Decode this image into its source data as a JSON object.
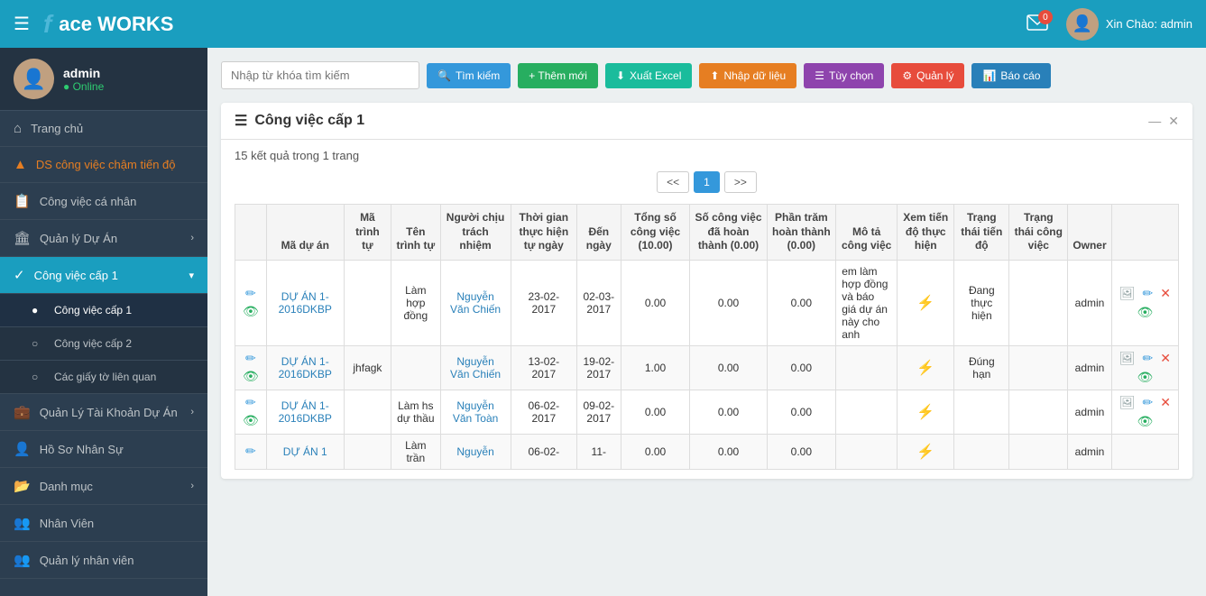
{
  "header": {
    "logo_face": "f",
    "logo_text": "ace WORKS",
    "hamburger": "☰",
    "mail_badge": "0",
    "greeting": "Xin Chào: admin"
  },
  "sidebar": {
    "user": {
      "name": "admin",
      "status": "● Online"
    },
    "items": [
      {
        "id": "home",
        "icon": "⌂",
        "label": "Trang chủ",
        "arrow": ""
      },
      {
        "id": "late-tasks",
        "icon": "▲",
        "label": "DS công việc chậm tiến độ",
        "arrow": ""
      },
      {
        "id": "personal-tasks",
        "icon": "📋",
        "label": "Công việc cá nhân",
        "arrow": ""
      },
      {
        "id": "project-mgmt",
        "icon": "🏛",
        "label": "Quản lý Dự Án",
        "arrow": "›"
      },
      {
        "id": "task-level1",
        "icon": "✓",
        "label": "Công việc cấp 1",
        "arrow": "▾",
        "active": true
      },
      {
        "id": "task-level1-sub",
        "label": "Công việc cấp 1",
        "sub": true,
        "active_sub": true
      },
      {
        "id": "task-level2-sub",
        "label": "Công việc cấp 2",
        "sub": true
      },
      {
        "id": "related-docs-sub",
        "label": "Các giấy tờ liên quan",
        "sub": true
      },
      {
        "id": "account-mgmt",
        "icon": "💼",
        "label": "Quản Lý Tài Khoản Dự Án",
        "arrow": "›"
      },
      {
        "id": "hr-profile",
        "icon": "👤",
        "label": "Hồ Sơ Nhân Sự",
        "arrow": ""
      },
      {
        "id": "catalog",
        "icon": "📂",
        "label": "Danh mục",
        "arrow": "›"
      },
      {
        "id": "staff",
        "icon": "👥",
        "label": "Nhân Viên",
        "arrow": ""
      },
      {
        "id": "staff-mgmt",
        "icon": "👥",
        "label": "Quản lý nhân viên",
        "arrow": ""
      }
    ]
  },
  "toolbar": {
    "search_placeholder": "Nhập từ khóa tìm kiếm",
    "btn_search": "Tìm kiếm",
    "btn_add": "+ Thêm mới",
    "btn_excel": "Xuất Excel",
    "btn_import": "Nhập dữ liệu",
    "btn_custom": "Tùy chọn",
    "btn_manage": "Quản lý",
    "btn_report": "Báo cáo"
  },
  "panel": {
    "title": "Công việc cấp 1",
    "result_count": "15 kết quả trong 1 trang",
    "pagination": {
      "prev": "<<",
      "page1": "1",
      "next": ">>"
    },
    "table": {
      "headers": [
        "Mã dự án",
        "Mã trình tự",
        "Tên trình tự",
        "Người chịu trách nhiệm",
        "Thời gian thực hiện tự ngày",
        "Đến ngày",
        "Tổng số công việc (10.00)",
        "Số công việc đã hoàn thành (0.00)",
        "Phần trăm hoàn thành (0.00)",
        "Mô tả công việc",
        "Xem tiến độ thực hiện",
        "Trạng thái tiến độ",
        "Trạng thái công việc",
        "Owner"
      ],
      "rows": [
        {
          "ma_du_an": "DỰ ÁN 1-2016DKBP",
          "ma_trinh_tu": "",
          "ten_trinh_tu": "Làm hợp đồng",
          "nguoi_chu_trach": "Nguyễn Văn Chiến",
          "tu_ngay": "23-02-2017",
          "den_ngay": "02-03-2017",
          "tong_so": "0.00",
          "da_hoan_thanh": "0.00",
          "phan_tram": "0.00",
          "mo_ta": "em làm hợp đồng và báo giá dự án này cho anh",
          "bolt": "⚡",
          "trang_thai_tien_do": "Đang thực hiện",
          "trang_thai_cv": "",
          "owner": "admin"
        },
        {
          "ma_du_an": "DỰ ÁN 1-2016DKBP",
          "ma_trinh_tu": "jhfagk",
          "ten_trinh_tu": "",
          "nguoi_chu_trach": "Nguyễn Văn Chiến",
          "tu_ngay": "13-02-2017",
          "den_ngay": "19-02-2017",
          "tong_so": "1.00",
          "da_hoan_thanh": "0.00",
          "phan_tram": "0.00",
          "mo_ta": "",
          "bolt": "⚡",
          "trang_thai_tien_do": "Đúng hạn",
          "trang_thai_cv": "",
          "owner": "admin"
        },
        {
          "ma_du_an": "DỰ ÁN 1-2016DKBP",
          "ma_trinh_tu": "",
          "ten_trinh_tu": "Làm hs dự thầu",
          "nguoi_chu_trach": "Nguyễn Văn Toàn",
          "tu_ngay": "06-02-2017",
          "den_ngay": "09-02-2017",
          "tong_so": "0.00",
          "da_hoan_thanh": "0.00",
          "phan_tram": "0.00",
          "mo_ta": "",
          "bolt": "⚡",
          "trang_thai_tien_do": "",
          "trang_thai_cv": "",
          "owner": "admin"
        },
        {
          "ma_du_an": "DỰ ÁN 1",
          "ma_trinh_tu": "",
          "ten_trinh_tu": "Làm trần",
          "nguoi_chu_trach": "Nguyễn",
          "tu_ngay": "06-02-",
          "den_ngay": "11-",
          "tong_so": "0.00",
          "da_hoan_thanh": "0.00",
          "phan_tram": "0.00",
          "mo_ta": "",
          "bolt": "⚡",
          "trang_thai_tien_do": "",
          "trang_thai_cv": "",
          "owner": "admin"
        }
      ]
    }
  }
}
